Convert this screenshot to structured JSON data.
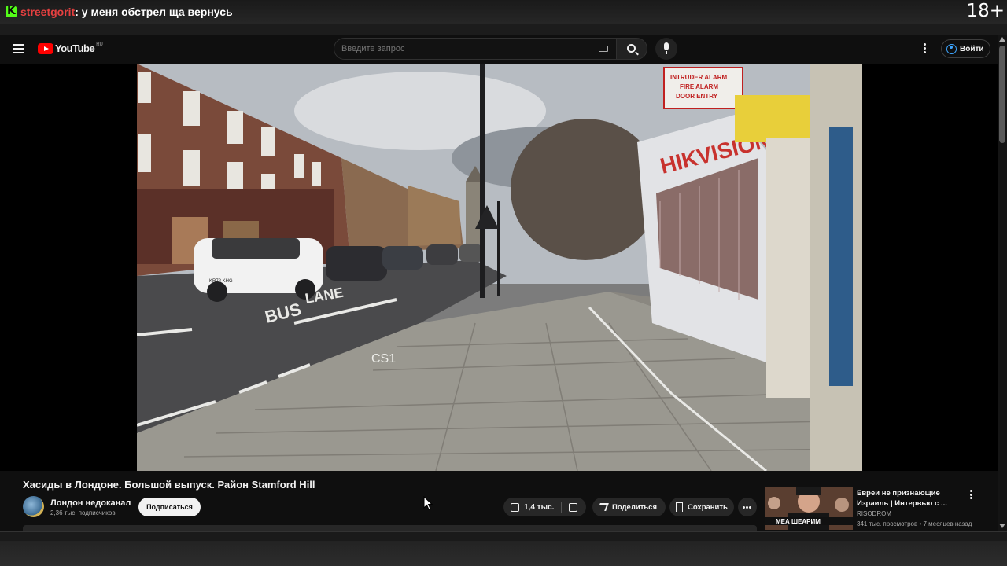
{
  "stream": {
    "username": "streetgorit",
    "message": ": у меня обстрел ща вернусь",
    "age_rating": "18+"
  },
  "header": {
    "logo_text": "YouTube",
    "region": "RU",
    "search_placeholder": "Введите запрос",
    "signin_label": "Войти"
  },
  "video": {
    "title": "Хасиды в Лондоне. Большой выпуск. Район Stamford Hill",
    "scene_text": {
      "shop_sign": "HIKVISION",
      "alarm_sign": [
        "INTRUDER ALARM",
        "FIRE ALARM",
        "DOOR ENTRY"
      ],
      "road_marking_bus": "BUS",
      "road_marking_lane": "LANE",
      "cycle_marking": "CS1",
      "plate": "KR72 KHG"
    }
  },
  "channel": {
    "name": "Лондон недоканал",
    "subscribers": "2,36 тыс. подписчиков",
    "subscribe_label": "Подписаться"
  },
  "actions": {
    "likes": "1,4 тыс.",
    "share_label": "Поделиться",
    "save_label": "Сохранить"
  },
  "recommendation": {
    "title": "Евреи не признающие Израиль | Интервью с ...",
    "channel": "RISODROM",
    "meta": "341 тыс. просмотров • 7 месяцев назад",
    "thumb_text": "МЕА ШЕАРИМ"
  },
  "colors": {
    "youtube_red": "#ff0000",
    "kick_green": "#53fc18",
    "link_blue": "#3ea6ff",
    "username_red": "#e64040"
  }
}
